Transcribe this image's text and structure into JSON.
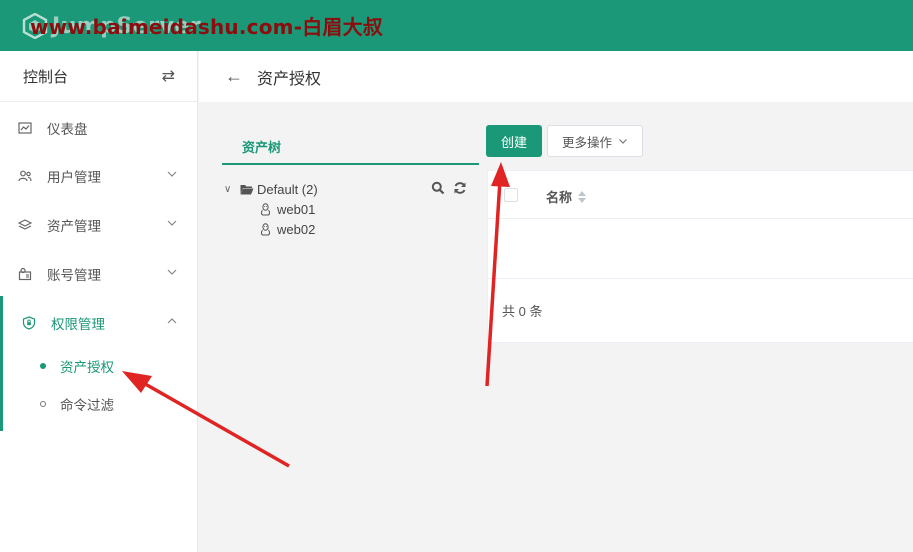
{
  "header": {
    "logo_text": "JumpServer",
    "watermark": "www.baimeidashu.com-白眉大叔",
    "bg_color": "#1a9877"
  },
  "sidebar": {
    "title": "控制台",
    "switch_icon": "swap-arrows-icon",
    "items": [
      {
        "label": "仪表盘",
        "icon": "dashboard-icon"
      },
      {
        "label": "用户管理",
        "icon": "users-icon",
        "expandable": true
      },
      {
        "label": "资产管理",
        "icon": "layers-icon",
        "expandable": true
      },
      {
        "label": "账号管理",
        "icon": "account-icon",
        "expandable": true
      },
      {
        "label": "权限管理",
        "icon": "shield-icon",
        "expandable": true,
        "expanded": true,
        "active": true
      }
    ],
    "subitems": [
      {
        "label": "资产授权",
        "active": true
      },
      {
        "label": "命令过滤",
        "active": false
      }
    ]
  },
  "page": {
    "title": "资产授权",
    "back_icon": "back-arrow-icon"
  },
  "tree": {
    "tab_label": "资产树",
    "root_label": "Default (2)",
    "nodes": [
      "web01",
      "web02"
    ]
  },
  "toolbar": {
    "create_label": "创建",
    "more_label": "更多操作"
  },
  "table": {
    "columns": [
      "名称"
    ],
    "rows": [],
    "total_text": "共 0 条"
  },
  "colors": {
    "accent": "#1a9877",
    "annotation_arrow": "#e02424"
  }
}
